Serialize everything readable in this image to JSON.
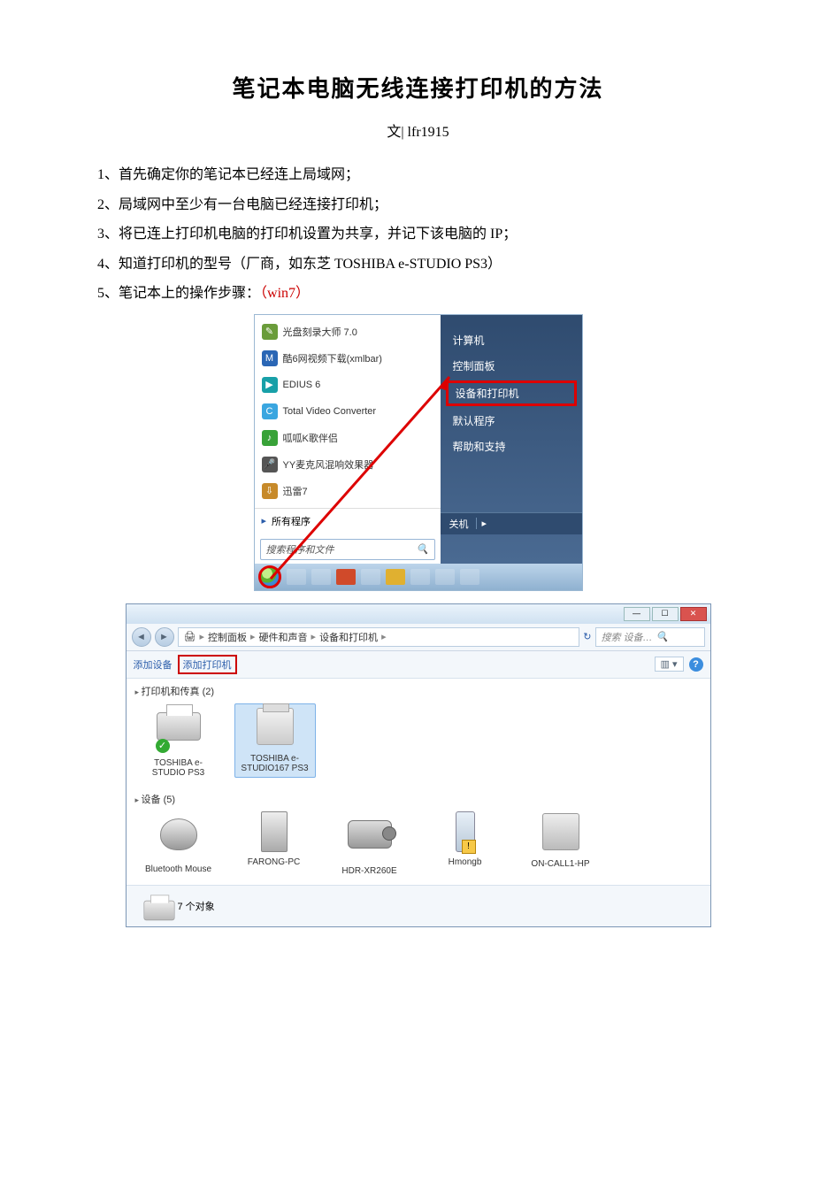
{
  "doc": {
    "title": "笔记本电脑无线连接打印机的方法",
    "author_prefix": "文|",
    "author": "lfr1915",
    "steps": [
      "1、首先确定你的笔记本已经连上局域网；",
      "2、局域网中至少有一台电脑已经连接打印机；",
      "3、将已连上打印机电脑的打印机设置为共享，并记下该电脑的 IP；",
      "4、知道打印机的型号（厂商，如东芝 TOSHIBA e-STUDIO PS3）"
    ],
    "step5_prefix": "5、笔记本上的操作步骤：",
    "step5_note": "（win7）"
  },
  "startmenu": {
    "left_items": [
      {
        "label": "光盘刻录大师 7.0",
        "color": "#6a9c3a"
      },
      {
        "label": "酷6网视频下载(xmlbar)",
        "color": "#2a66b5"
      },
      {
        "label": "EDIUS 6",
        "color": "#18a0a8"
      },
      {
        "label": "Total Video Converter",
        "color": "#3aa6e0"
      },
      {
        "label": "呱呱K歌伴侣",
        "color": "#38a238"
      },
      {
        "label": "YY麦克风混响效果器",
        "color": "#555"
      },
      {
        "label": "迅雷7",
        "color": "#c78a2a"
      }
    ],
    "all_programs": "所有程序",
    "search_placeholder": "搜索程序和文件",
    "right_items": [
      "计算机",
      "控制面板",
      "设备和打印机",
      "默认程序",
      "帮助和支持"
    ],
    "highlighted_right_index": 2,
    "shutdown": "关机"
  },
  "devwin": {
    "crumbs": [
      "控制面板",
      "硬件和声音",
      "设备和打印机"
    ],
    "search_placeholder": "搜索 设备…",
    "cmd_add_device": "添加设备",
    "cmd_add_printer": "添加打印机",
    "view_label": "▥ ▾",
    "sect_printers": "打印机和传真 (2)",
    "printers": [
      {
        "name": "TOSHIBA e-STUDIO PS3",
        "default": true
      },
      {
        "name": "TOSHIBA e-STUDIO167 PS3",
        "selected": true
      }
    ],
    "sect_devices": "设备 (5)",
    "devices": [
      {
        "name": "Bluetooth Mouse",
        "kind": "mouse"
      },
      {
        "name": "FARONG-PC",
        "kind": "tower"
      },
      {
        "name": "HDR-XR260E",
        "kind": "cam"
      },
      {
        "name": "Hmongb",
        "kind": "phone",
        "warn": true
      },
      {
        "name": "ON-CALL1-HP",
        "kind": "drive"
      }
    ],
    "status_count": "7 个对象"
  }
}
